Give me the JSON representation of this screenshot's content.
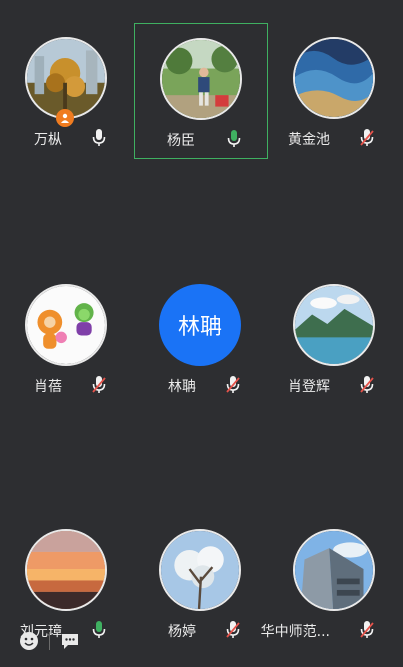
{
  "participants": [
    {
      "name": "万枞",
      "mic": "on",
      "host": true,
      "avatar_icon": "photo-autumn-tree"
    },
    {
      "name": "杨臣",
      "mic": "speaking",
      "active": true,
      "avatar_icon": "photo-person-garden"
    },
    {
      "name": "黄金池",
      "mic": "muted",
      "avatar_icon": "photo-blue-wave"
    },
    {
      "name": "肖蓓",
      "mic": "muted",
      "avatar_icon": "cartoon-characters"
    },
    {
      "name": "林聃",
      "mic": "muted",
      "avatar_text": "林聃"
    },
    {
      "name": "肖登辉",
      "mic": "muted",
      "avatar_icon": "photo-lake-mountains"
    },
    {
      "name": "刘元璋",
      "mic": "speaking",
      "avatar_icon": "photo-sunset"
    },
    {
      "name": "杨婷",
      "mic": "muted",
      "avatar_icon": "photo-blossom-tree"
    },
    {
      "name": "华中师范...",
      "mic": "muted",
      "avatar_icon": "photo-building"
    }
  ],
  "colors": {
    "background": "#2d2e31",
    "active_border": "#3fb061",
    "mic_speaking": "#3fb061",
    "mic_muted_slash": "#e5534b",
    "text_avatar": "#1a73f6",
    "host_badge": "#f07c20"
  },
  "bottom_bar": {
    "icons": [
      "emoji-icon",
      "chat-icon"
    ]
  }
}
